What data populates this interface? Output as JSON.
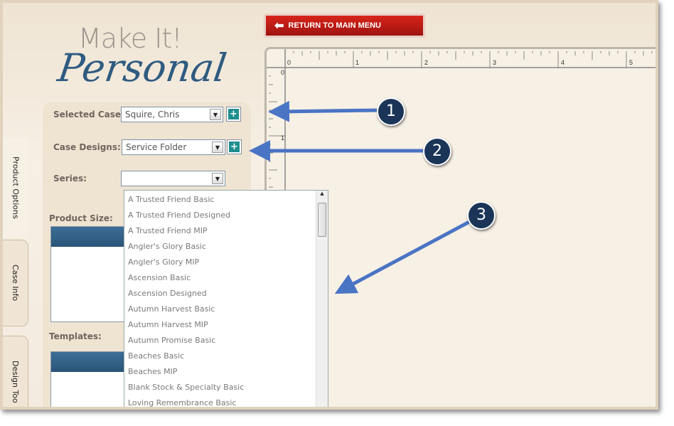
{
  "logo": {
    "line1": "Make It!",
    "line2": "Personal"
  },
  "header": {
    "return_label": "RETURN TO MAIN MENU"
  },
  "tabs": [
    {
      "label": "Product Options",
      "active": true
    },
    {
      "label": "Case Info"
    },
    {
      "label": "Design Too"
    }
  ],
  "form": {
    "selected_case": {
      "label": "Selected Case:",
      "value": "Squire, Chris"
    },
    "case_designs": {
      "label": "Case Designs:",
      "value": "Service Folder"
    },
    "series": {
      "label": "Series:",
      "value": ""
    },
    "product_size": {
      "label": "Product Size:"
    },
    "templates": {
      "label": "Templates:"
    }
  },
  "series_options": [
    "A Trusted Friend Basic",
    "A Trusted Friend Designed",
    "A Trusted Friend MIP",
    "Angler's Glory Basic",
    "Angler's Glory MIP",
    "Ascension Basic",
    "Ascension Designed",
    "Autumn Harvest Basic",
    "Autumn Harvest MIP",
    "Autumn Promise Basic",
    "Beaches Basic",
    "Beaches MIP",
    "Blank Stock & Specialty Basic",
    "Loving Remembrance Basic"
  ],
  "ruler": {
    "h": [
      "0",
      "1",
      "2",
      "3",
      "4",
      "5"
    ],
    "v": [
      "0",
      "1"
    ]
  },
  "callouts": [
    "1",
    "2",
    "3"
  ],
  "colors": {
    "accent": "#2f5b80",
    "button": "#c21d16",
    "callout": "#1b3558",
    "arrow": "#4a74c4"
  }
}
